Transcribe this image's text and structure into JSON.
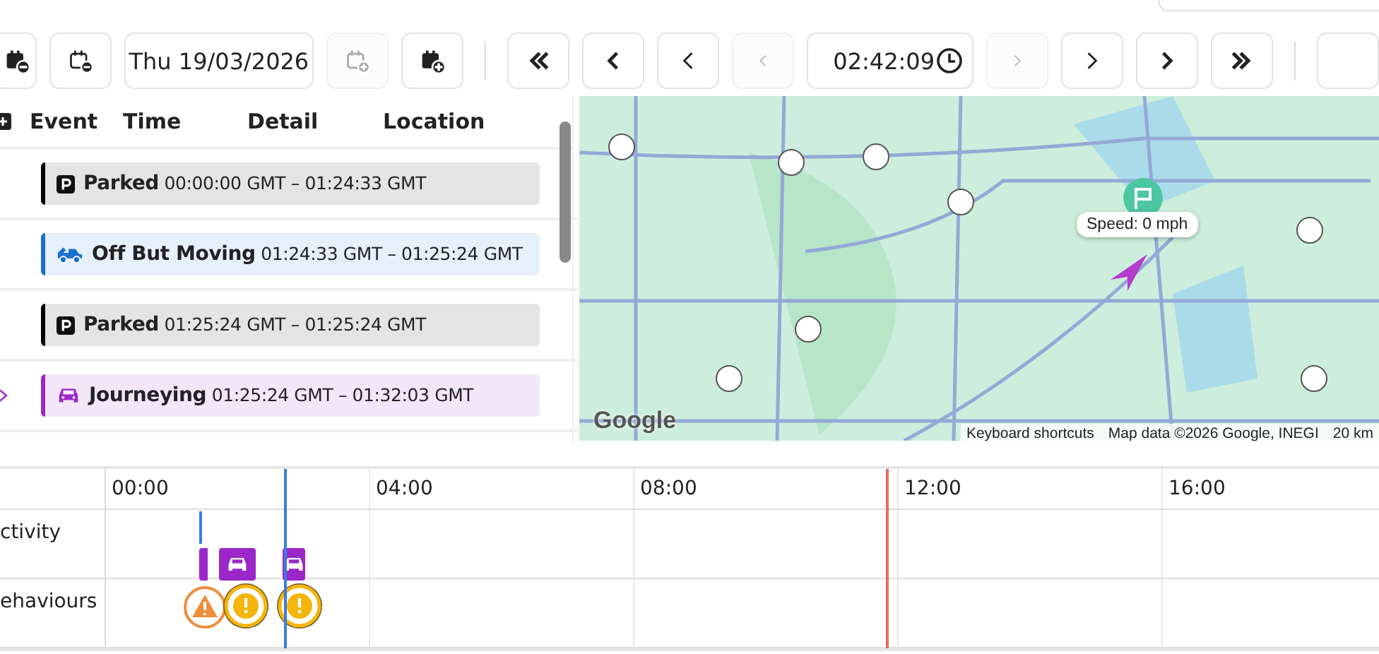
{
  "toolbar": {
    "left_buttons": [
      {
        "kind": "calendar-minus-filled",
        "disabled": false
      },
      {
        "kind": "calendar-minus",
        "disabled": false
      }
    ],
    "date": "Thu 19/03/2026",
    "mid_buttons": [
      {
        "kind": "calendar-plus",
        "disabled": true
      },
      {
        "kind": "calendar-plus-filled",
        "disabled": false
      }
    ],
    "back_buttons": [
      {
        "kind": "double",
        "disabled": false
      },
      {
        "kind": "bold",
        "disabled": false
      },
      {
        "kind": "thin",
        "disabled": false
      },
      {
        "kind": "thin",
        "disabled": true
      }
    ],
    "time": "02:42:09",
    "forward_buttons": [
      {
        "kind": "thin",
        "disabled": true
      },
      {
        "kind": "thin",
        "disabled": false
      },
      {
        "kind": "bold",
        "disabled": false
      },
      {
        "kind": "double",
        "disabled": false
      }
    ]
  },
  "table": {
    "columns": [
      "Event",
      "Time",
      "Detail",
      "Location"
    ],
    "rows": [
      {
        "kind": "parked",
        "label": "Parked",
        "time": "00:00:00 GMT – 01:24:33 GMT",
        "color": "#000000",
        "selected": false
      },
      {
        "kind": "off_moving",
        "label": "Off But Moving",
        "time": "01:24:33 GMT – 01:25:24 GMT",
        "color": "#1a6fd1",
        "selected": false
      },
      {
        "kind": "parked",
        "label": "Parked",
        "time": "01:25:24 GMT – 01:25:24 GMT",
        "color": "#000000",
        "selected": false
      },
      {
        "kind": "journeying",
        "label": "Journeying",
        "time": "01:25:24 GMT – 01:32:03 GMT",
        "color": "#9b27c9",
        "selected": true
      }
    ]
  },
  "map": {
    "tooltip": "Speed: 0 mph",
    "logo": "Google",
    "shortcuts": "Keyboard shortcuts",
    "attribution": "Map data ©2026 Google, INEGI",
    "scale": "20 km"
  },
  "timeline": {
    "ticks": [
      "00:00",
      "04:00",
      "08:00",
      "12:00",
      "16:00"
    ],
    "rows": [
      "ctivity",
      "ehaviours"
    ],
    "activity": [
      {
        "kind": "bar"
      },
      {
        "kind": "car"
      },
      {
        "kind": "car"
      }
    ],
    "behaviours": [
      {
        "kind": "warning"
      },
      {
        "kind": "alert"
      },
      {
        "kind": "alert"
      }
    ]
  }
}
